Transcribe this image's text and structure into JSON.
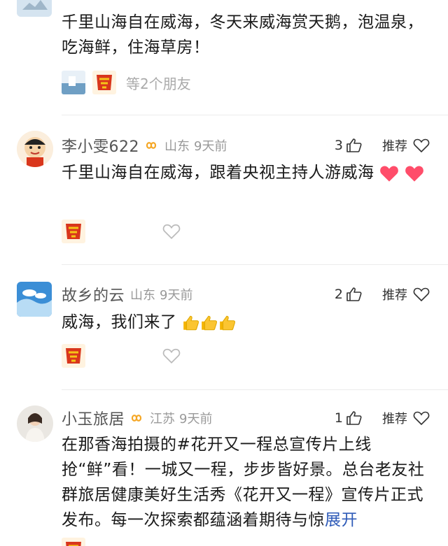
{
  "comments": [
    {
      "name": "",
      "location": "",
      "time": "",
      "text": "千里山海自在威海，冬天来威海赏天鹅，泡温泉，吃海鲜，住海草房！",
      "friends_text": "等2个朋友"
    },
    {
      "name": "李小雯622",
      "location": "山东",
      "time": "9天前",
      "likes": "3",
      "recommend_label": "推荐",
      "text": "千里山海自在威海，跟着央视主持人游威海"
    },
    {
      "name": "故乡的云",
      "location": "山东",
      "time": "9天前",
      "likes": "2",
      "recommend_label": "推荐",
      "text": "威海，我们来了"
    },
    {
      "name": "小玉旅居",
      "location": "江苏",
      "time": "9天前",
      "likes": "1",
      "recommend_label": "推荐",
      "text": "在那香海拍摄的#花开又一程总宣传片上线 抢“鲜”看！一城又一程，步步皆好景。总台老友社群旅居健康美好生活秀《花开又一程》宣传片正式发布。每一次探索都蕴涵着期待与惊",
      "expand_label": "展开"
    }
  ],
  "colors": {
    "link": "#2f5bb8",
    "heart": "#ff4d6a",
    "badge": "#f5a623"
  },
  "icons": {
    "thumb": "thumb-up-icon",
    "heart": "heart-outline-icon",
    "badge": "infinity-badge-icon"
  }
}
